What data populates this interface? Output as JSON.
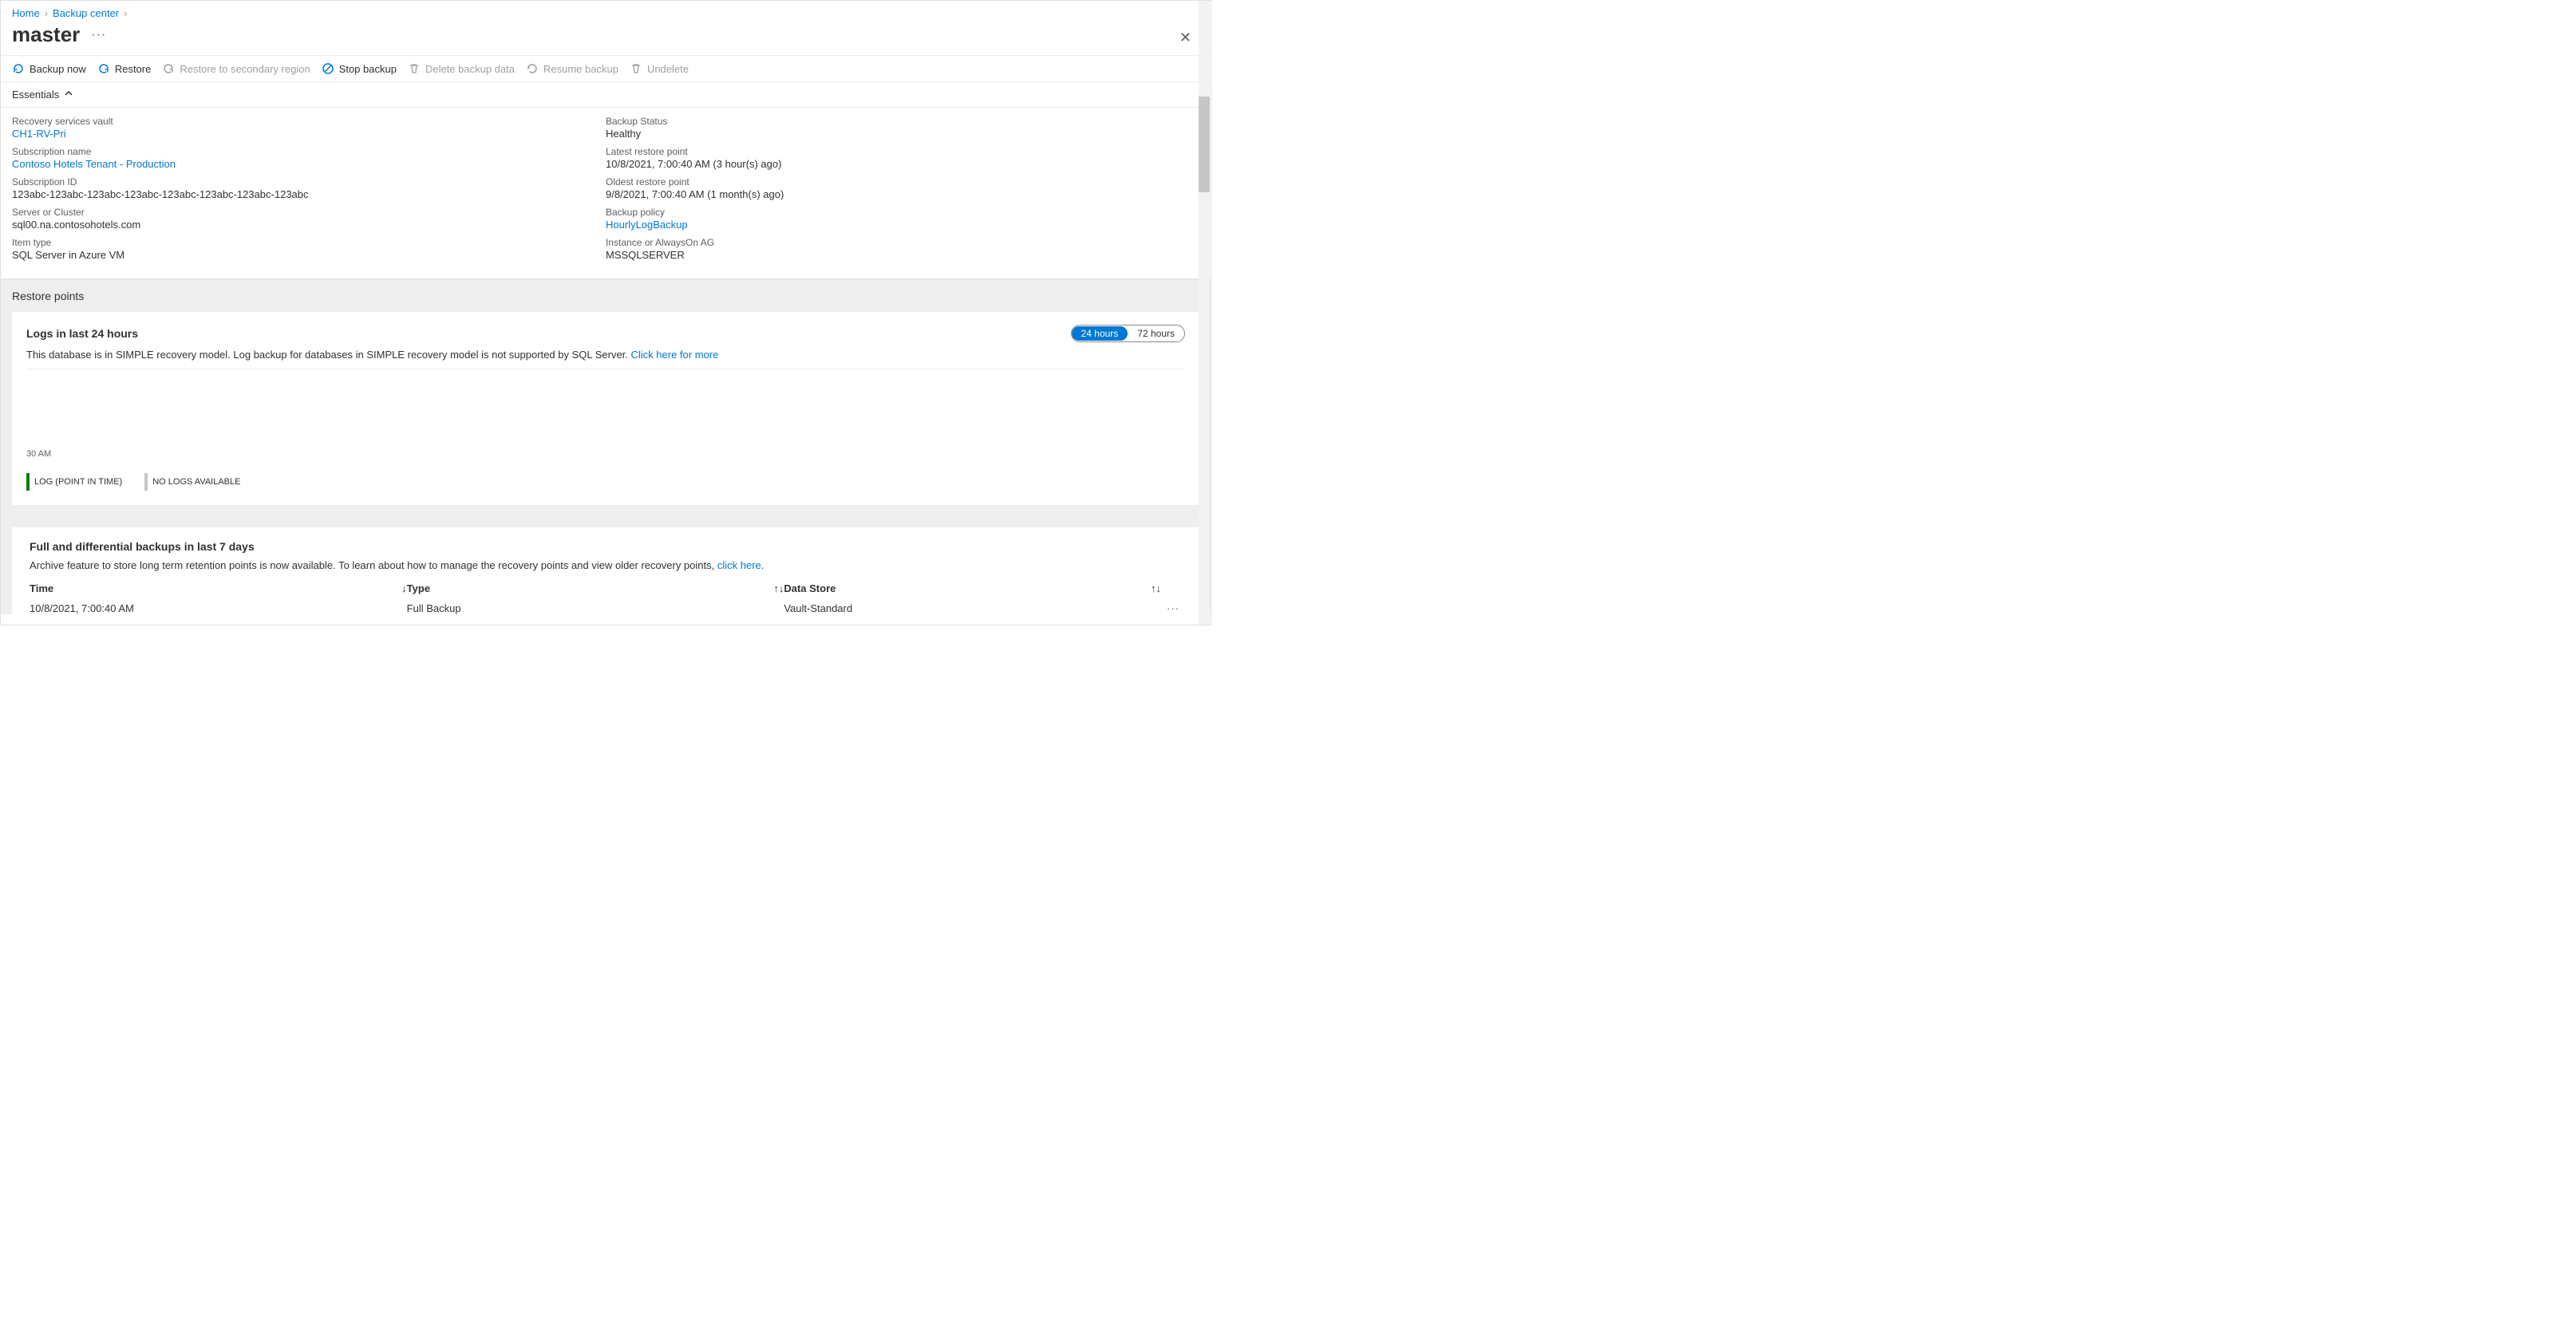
{
  "breadcrumbs": {
    "home": "Home",
    "backup_center": "Backup center"
  },
  "title": "master",
  "toolbar": {
    "backup_now": "Backup now",
    "restore": "Restore",
    "restore_secondary": "Restore to secondary region",
    "stop_backup": "Stop backup",
    "delete_backup": "Delete backup data",
    "resume_backup": "Resume backup",
    "undelete": "Undelete"
  },
  "essentials_label": "Essentials",
  "essentials": {
    "left": [
      {
        "label": "Recovery services vault",
        "value": "CH1-RV-Pri",
        "link": true
      },
      {
        "label": "Subscription name",
        "value": "Contoso Hotels Tenant - Production",
        "link": true
      },
      {
        "label": "Subscription ID",
        "value": "123abc-123abc-123abc-123abc-123abc-123abc-123abc-123abc",
        "mono": true
      },
      {
        "label": "Server or Cluster",
        "value": "sql00.na.contosohotels.com"
      },
      {
        "label": "Item type",
        "value": "SQL Server in Azure VM"
      }
    ],
    "right": [
      {
        "label": "Backup Status",
        "value": "Healthy"
      },
      {
        "label": "Latest restore point",
        "value": "10/8/2021, 7:00:40 AM (3 hour(s) ago)"
      },
      {
        "label": "Oldest restore point",
        "value": "9/8/2021, 7:00:40 AM (1 month(s) ago)"
      },
      {
        "label": "Backup policy",
        "value": "HourlyLogBackup",
        "link": true
      },
      {
        "label": "Instance or AlwaysOn AG",
        "value": "MSSQLSERVER"
      }
    ]
  },
  "restore_points_header": "Restore points",
  "logs_panel": {
    "title": "Logs in last 24 hours",
    "desc_text": "This database is in SIMPLE recovery model. Log backup for databases in SIMPLE recovery model is not supported by SQL Server. ",
    "desc_link": "Click here for more",
    "toggle_24": "24 hours",
    "toggle_72": "72 hours",
    "axis_label": "30 AM",
    "legend_log": "LOG (POINT IN TIME)",
    "legend_none": "NO LOGS AVAILABLE"
  },
  "backups_panel": {
    "title": "Full and differential backups in last 7 days",
    "desc_text": "Archive feature to store long term retention points is now available. To learn about how to manage the recovery points and view older recovery points, ",
    "desc_link": "click here",
    "col_time": "Time",
    "col_type": "Type",
    "col_store": "Data Store",
    "rows": [
      {
        "time": "10/8/2021, 7:00:40 AM",
        "type": "Full Backup",
        "store": "Vault-Standard"
      }
    ]
  }
}
